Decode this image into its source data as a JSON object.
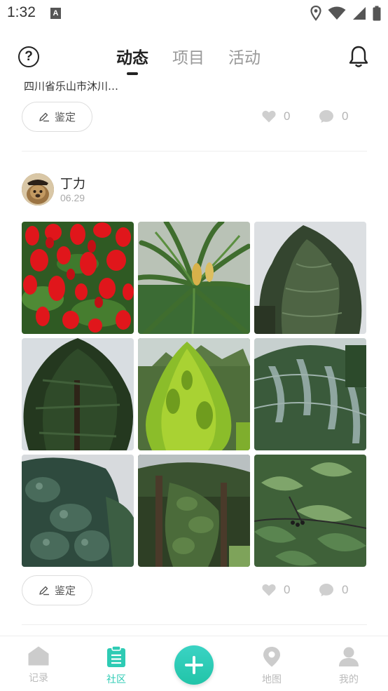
{
  "status_bar": {
    "time": "1:32",
    "notification_letter": "A"
  },
  "header": {
    "tabs": [
      {
        "label": "动态",
        "active": true
      },
      {
        "label": "项目",
        "active": false
      },
      {
        "label": "活动",
        "active": false
      }
    ]
  },
  "feed": {
    "previous_post": {
      "location_partial": "四川省乐山市沐川…",
      "identify_label": "鉴定",
      "likes": "0",
      "comments": "0"
    },
    "post": {
      "username": "丁力",
      "date": "06.29",
      "photos": [
        "red-salvia-flowers",
        "cycad-palm",
        "tall-conifer-tree",
        "dark-spruce-tree",
        "yellow-green-cypress",
        "weeping-conifer",
        "blue-green-juniper",
        "vine-covered-trees",
        "broadleaf-leaves"
      ],
      "identify_label": "鉴定",
      "likes": "0",
      "comments": "0"
    }
  },
  "bottom_nav": {
    "items": [
      {
        "label": "记录",
        "icon": "home-icon",
        "active": false
      },
      {
        "label": "社区",
        "icon": "clipboard-icon",
        "active": true
      },
      {
        "label": "地图",
        "icon": "map-pin-icon",
        "active": false
      },
      {
        "label": "我的",
        "icon": "user-icon",
        "active": false
      }
    ],
    "add_icon": "plus-icon"
  },
  "colors": {
    "accent": "#2ecbb4",
    "muted": "#bbbbbb",
    "text": "#222222"
  }
}
